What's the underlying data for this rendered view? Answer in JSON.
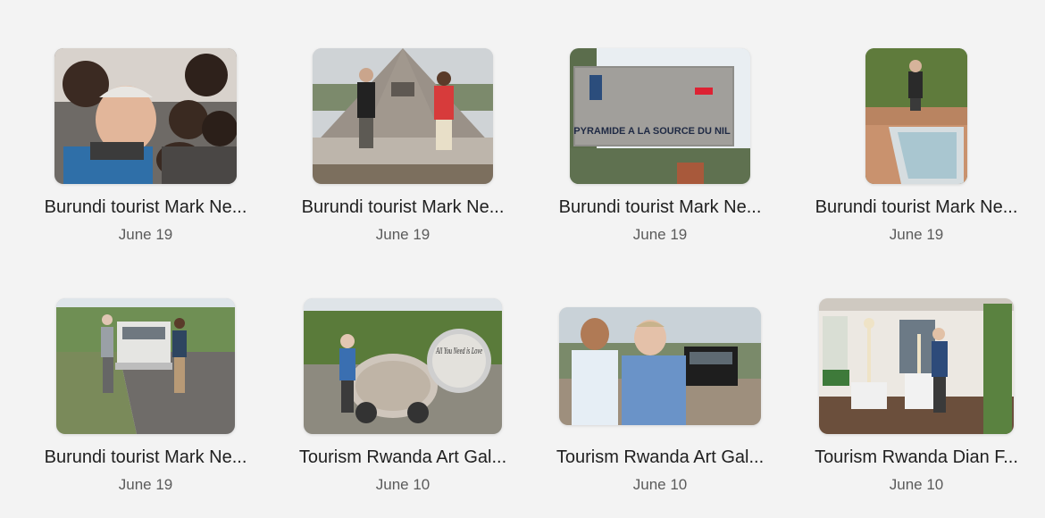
{
  "gallery": {
    "items": [
      {
        "title": "Burundi tourist Mark Ne...",
        "date": "June 19"
      },
      {
        "title": "Burundi tourist Mark Ne...",
        "date": "June 19"
      },
      {
        "title": "Burundi tourist Mark Ne...",
        "date": "June 19",
        "sign_text": "PYRAMIDE A LA SOURCE DU NIL"
      },
      {
        "title": "Burundi tourist Mark Ne...",
        "date": "June 19"
      },
      {
        "title": "Burundi tourist Mark Ne...",
        "date": "June 19"
      },
      {
        "title": "Tourism Rwanda Art Gal...",
        "date": "June 10",
        "art_text": "All You Need is Love"
      },
      {
        "title": "Tourism Rwanda Art Gal...",
        "date": "June 10"
      },
      {
        "title": "Tourism Rwanda Dian F...",
        "date": "June 10"
      }
    ]
  },
  "colors": {
    "background": "#f3f3f3",
    "title": "#1f1f1f",
    "date": "#5b5b5b"
  }
}
